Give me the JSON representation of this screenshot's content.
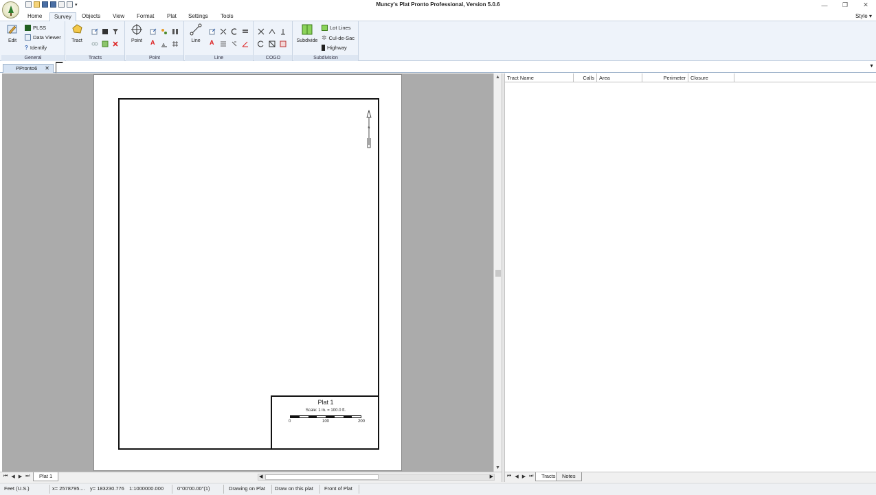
{
  "window": {
    "title": "Muncy's Plat Pronto Professional, Version 5.0.6",
    "controls": [
      "—",
      "❐",
      "✕"
    ]
  },
  "menu": {
    "tabs": [
      "Home",
      "Survey",
      "Objects",
      "View",
      "Format",
      "Plat",
      "Settings",
      "Tools"
    ],
    "active": "Survey",
    "style_label": "Style ▾"
  },
  "ribbon": {
    "general": {
      "label": "General",
      "edit": "Edit",
      "plss": "PLSS",
      "data_viewer": "Data Viewer",
      "identify": "Identify"
    },
    "tracts": {
      "label": "Tracts",
      "tract": "Tract"
    },
    "point": {
      "label": "Point",
      "point": "Point"
    },
    "line": {
      "label": "Line",
      "line": "Line"
    },
    "cogo": {
      "label": "COGO"
    },
    "subdivision": {
      "label": "Subdivision",
      "subdivide": "Subdivide",
      "lot_lines": "Lot Lines",
      "cul_de_sac": "Cul-de-Sac",
      "highway": "Highway"
    }
  },
  "document": {
    "tab_name": "PPronto6",
    "close": "✕"
  },
  "plat": {
    "title": "Plat 1",
    "scale_text": "Scale: 1 in. = 100.0 ft.",
    "scale_ticks": [
      "0",
      "100",
      "200"
    ]
  },
  "grid": {
    "columns": [
      "Tract Name",
      "Calls",
      "Area",
      "Perimeter",
      "Closure"
    ]
  },
  "sheets": {
    "left": [
      "Plat 1"
    ],
    "right": [
      "Tracts",
      "Notes"
    ]
  },
  "status": {
    "units": "Feet (U.S.)",
    "x": "x= 2578795....",
    "y": "y= 183230.776",
    "scale": "1:1000000.000",
    "angle": "0°00'00.00\"(1)",
    "mode": "Drawing on Plat",
    "draw_target": "Draw on this plat",
    "side": "Front of Plat"
  },
  "colors": {
    "ribbon_bg": "#eef3fa",
    "canvas_bg": "#ababab",
    "accent_green": "#2f7d2f"
  }
}
